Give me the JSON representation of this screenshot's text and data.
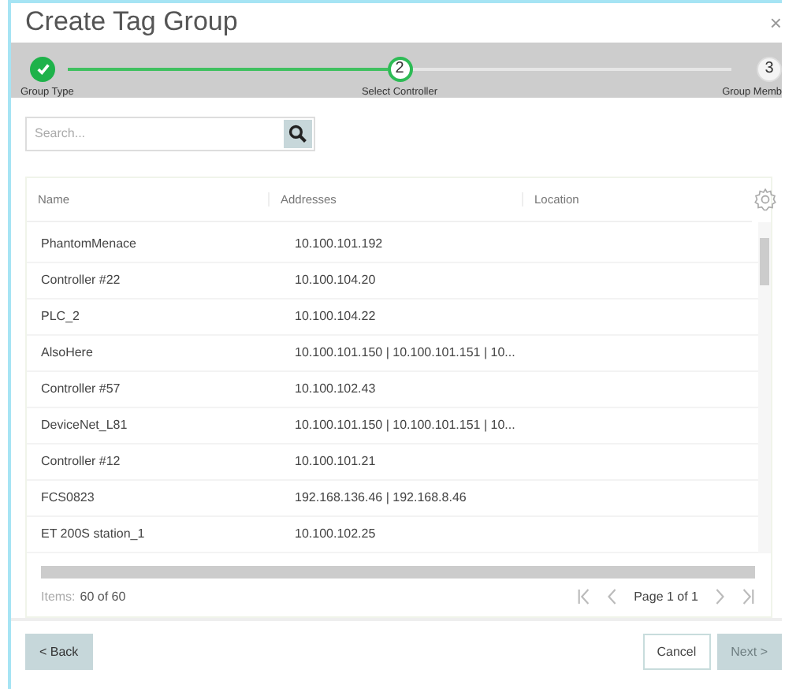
{
  "dialog": {
    "title": "Create Tag Group",
    "close": "×"
  },
  "steps": [
    {
      "label": "Group Type",
      "completed": true,
      "selected": false
    },
    {
      "number": "2",
      "label": "Select Controller",
      "completed": false,
      "selected": true
    },
    {
      "number": "3",
      "label": "Group Memb",
      "completed": false,
      "selected": false
    }
  ],
  "search": {
    "placeholder": "Search..."
  },
  "table": {
    "columns": [
      "Name",
      "Addresses",
      "Location"
    ],
    "rows": [
      [
        "PhantomMenace",
        "10.100.101.192"
      ],
      [
        "Controller #22",
        "10.100.104.20"
      ],
      [
        "PLC_2",
        "10.100.104.22"
      ],
      [
        "AlsoHere",
        "10.100.101.150 | 10.100.101.151 | 10..."
      ],
      [
        "Controller #57",
        "10.100.102.43"
      ],
      [
        "DeviceNet_L81",
        "10.100.101.150 | 10.100.101.151 | 10..."
      ],
      [
        "Controller #12",
        "10.100.101.21"
      ],
      [
        "FCS0823",
        "192.168.136.46 | 192.168.8.46"
      ],
      [
        "ET 200S station_1",
        "10.100.102.25"
      ]
    ]
  },
  "pager": {
    "items_label": "Items:",
    "items_count": "60 of 60",
    "page": "Page 1 of 1"
  },
  "buttons": [
    {
      "label": "< Back",
      "kind": "secondary",
      "disabled": false
    },
    {
      "label": "Cancel",
      "kind": "outline",
      "disabled": false
    },
    {
      "label": "Next >",
      "kind": "primary",
      "disabled": true
    }
  ]
}
